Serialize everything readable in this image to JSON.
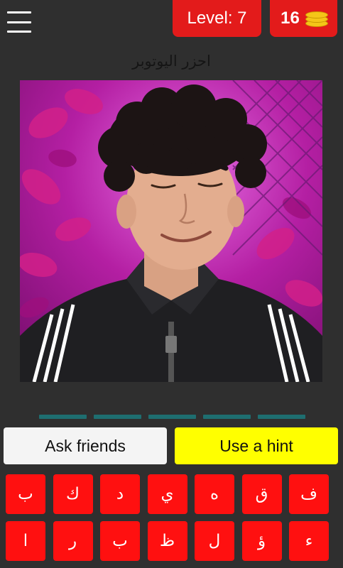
{
  "header": {
    "menu_icon": "hamburger-menu-icon",
    "level_label": "Level: 7",
    "coins": "16",
    "coin_icon": "coin-stack-icon",
    "badge_color": "#e31b1b"
  },
  "prompt": "احزر اليوتوبر",
  "answer": {
    "slot_count": 5
  },
  "actions": {
    "ask_label": "Ask friends",
    "hint_label": "Use a hint"
  },
  "keyboard": {
    "row1": [
      "ف",
      "ق",
      "ه",
      "ي",
      "د",
      "ك",
      "ب"
    ],
    "row2": [
      "ء",
      "ؤ",
      "ل",
      "ظ",
      "ب",
      "ر",
      "ا"
    ],
    "key_color": "#ff1010"
  }
}
